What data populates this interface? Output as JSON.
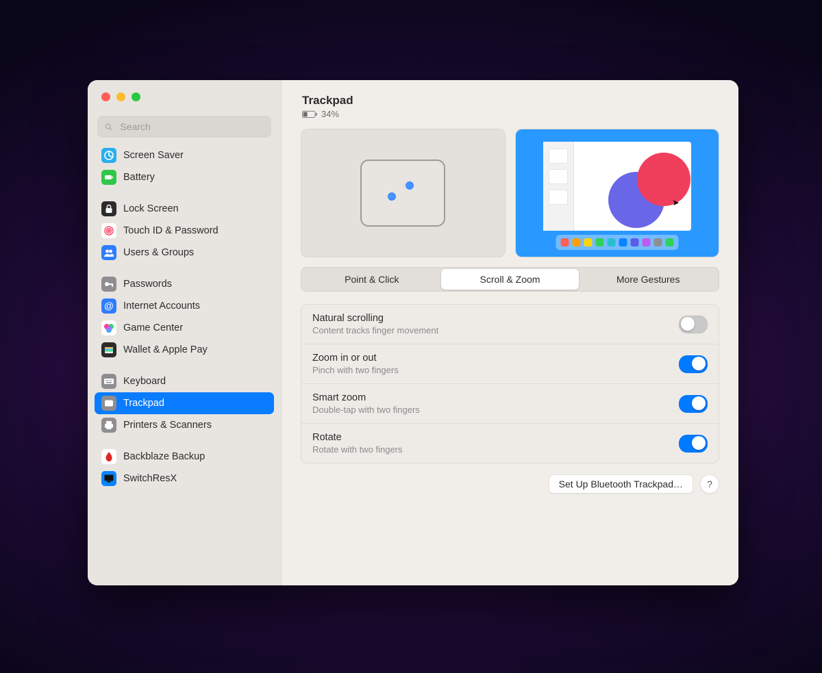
{
  "header": {
    "title": "Trackpad",
    "battery_pct": "34%"
  },
  "search": {
    "placeholder": "Search"
  },
  "sidebar": {
    "items": [
      {
        "label": "Screen Saver",
        "icon": "screensaver",
        "bg": "#29aef0"
      },
      {
        "label": "Battery",
        "icon": "battery",
        "bg": "#31c74b"
      },
      {
        "label": "Lock Screen",
        "icon": "lock",
        "bg": "#2c2c2c"
      },
      {
        "label": "Touch ID & Password",
        "icon": "touch-id",
        "bg": "#ffffff"
      },
      {
        "label": "Users & Groups",
        "icon": "users",
        "bg": "#2f7dff"
      },
      {
        "label": "Passwords",
        "icon": "key",
        "bg": "#8e8e92"
      },
      {
        "label": "Internet Accounts",
        "icon": "at",
        "bg": "#2f7dff"
      },
      {
        "label": "Game Center",
        "icon": "game-center",
        "bg": "#ffffff"
      },
      {
        "label": "Wallet & Apple Pay",
        "icon": "wallet",
        "bg": "#2c2c2c"
      },
      {
        "label": "Keyboard",
        "icon": "keyboard",
        "bg": "#8e8e92"
      },
      {
        "label": "Trackpad",
        "icon": "trackpad",
        "bg": "#8e8e92",
        "selected": true
      },
      {
        "label": "Printers & Scanners",
        "icon": "printer",
        "bg": "#8e8e92"
      },
      {
        "label": "Backblaze Backup",
        "icon": "backblaze",
        "bg": "#ffffff"
      },
      {
        "label": "SwitchResX",
        "icon": "switchres",
        "bg": "#0a84ff"
      }
    ]
  },
  "tabs": {
    "options": [
      "Point & Click",
      "Scroll & Zoom",
      "More Gestures"
    ],
    "selected_index": 1
  },
  "options": [
    {
      "title": "Natural scrolling",
      "subtitle": "Content tracks finger movement",
      "on": false
    },
    {
      "title": "Zoom in or out",
      "subtitle": "Pinch with two fingers",
      "on": true
    },
    {
      "title": "Smart zoom",
      "subtitle": "Double-tap with two fingers",
      "on": true
    },
    {
      "title": "Rotate",
      "subtitle": "Rotate with two fingers",
      "on": true
    }
  ],
  "footer": {
    "setup_label": "Set Up Bluetooth Trackpad…",
    "help_label": "?"
  },
  "dock_colors": [
    "#ff5f57",
    "#ff9f0a",
    "#ffd60a",
    "#30d158",
    "#2bbed0",
    "#0a84ff",
    "#5e5ce6",
    "#bf5af2",
    "#8e8e92",
    "#30d158"
  ]
}
